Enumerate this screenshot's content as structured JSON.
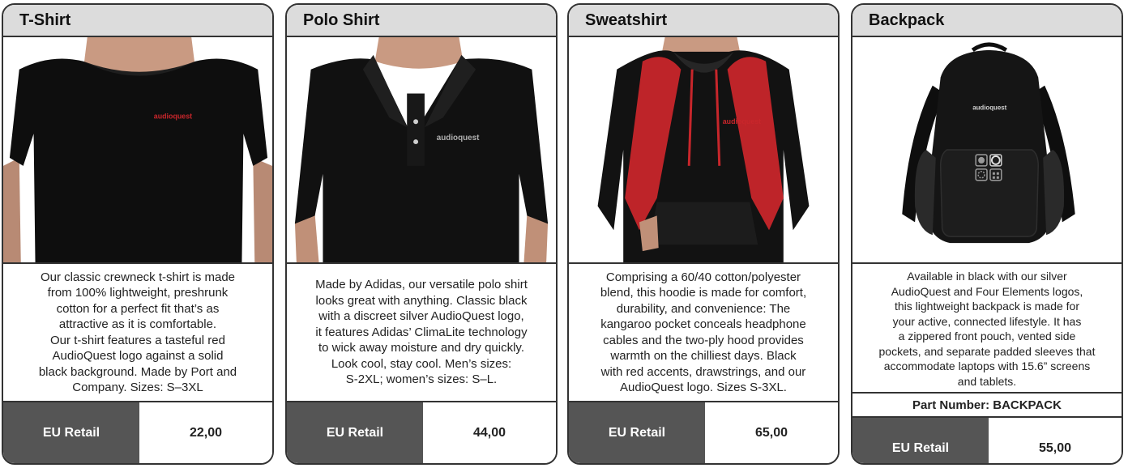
{
  "products": [
    {
      "title": "T-Shirt",
      "photo_icon": "tshirt-photo",
      "photo_logo": "audioquest",
      "description_lines": [
        "Our classic crewneck t-shirt is made",
        "from 100% lightweight, preshrunk",
        "cotton for a perfect fit that’s as",
        "attractive as it is comfortable.",
        "Our t-shirt features a tasteful red",
        "AudioQuest logo against a solid",
        "black background. Made by Port and",
        "Company. Sizes: S–3XL"
      ],
      "price_label": "EU Retail",
      "price": "22,00"
    },
    {
      "title": "Polo Shirt",
      "photo_icon": "polo-shirt-photo",
      "photo_logo": "audioquest",
      "description_lines": [
        "Made by Adidas, our versatile polo shirt",
        "looks great with anything. Classic black",
        "with a discreet silver AudioQuest logo,",
        "it features Adidas’ ClimaLite technology",
        "to wick away moisture and dry quickly.",
        "Look cool, stay cool. Men’s sizes:",
        "S-2XL; women’s sizes: S–L."
      ],
      "price_label": "EU Retail",
      "price": "44,00"
    },
    {
      "title": "Sweatshirt",
      "photo_icon": "hoodie-photo",
      "photo_logo": "audioquest",
      "description_lines": [
        "Comprising a 60/40 cotton/polyester",
        "blend, this hoodie is made for comfort,",
        "durability, and convenience: The",
        "kangaroo pocket conceals headphone",
        "cables and the two-ply hood provides",
        "warmth on the chilliest days. Black",
        "with red accents, drawstrings, and our",
        "AudioQuest logo. Sizes S-3XL."
      ],
      "price_label": "EU Retail",
      "price": "65,00"
    },
    {
      "title": "Backpack",
      "photo_icon": "backpack-photo",
      "photo_logo": "audioquest",
      "description_lines": [
        "Available in black with our silver",
        "AudioQuest and Four Elements logos,",
        "this lightweight backpack is made for",
        "your active, connected lifestyle. It has",
        "a zippered front pouch, vented side",
        "pockets, and separate padded sleeves that",
        "accommodate laptops with 15.6” screens",
        "and tablets."
      ],
      "part_number": "Part Number: BACKPACK",
      "price_label": "EU Retail",
      "price": "55,00"
    }
  ],
  "colors": {
    "header_bg": "#dcdcdc",
    "label_bg": "#555555",
    "border": "#333333",
    "logo_red": "#c8262b",
    "logo_silver": "#b0b0b0"
  }
}
